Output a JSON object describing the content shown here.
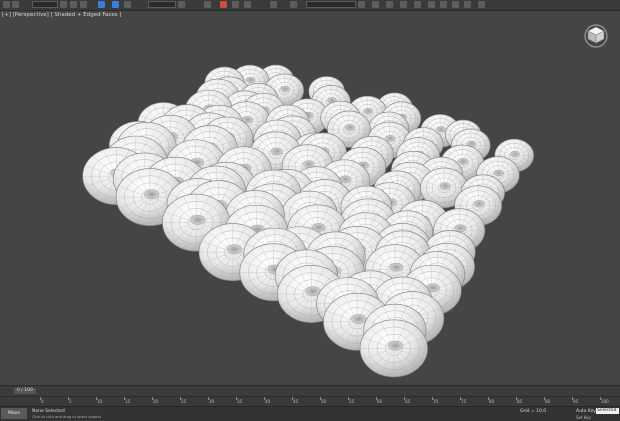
{
  "viewport": {
    "label": "[+] [Perspective] [ Shaded + Edged Faces ]"
  },
  "timeline": {
    "frame_counter": "0 / 100",
    "ticks": [
      "0",
      "5",
      "10",
      "15",
      "20",
      "25",
      "30",
      "35",
      "40",
      "45",
      "50",
      "55",
      "60",
      "65",
      "70",
      "75",
      "80",
      "85",
      "90",
      "95",
      "100"
    ]
  },
  "status": {
    "script_button": "Maxs",
    "selection": "None Selected",
    "prompt": "Click or click-and-drag to select objects",
    "grid": "Grid = 10,0",
    "autokey": "Auto Key",
    "selected_value": "Selected",
    "set_key": "Set Key"
  },
  "colors": {
    "background": "#454545",
    "mesh": "#e6e6e6",
    "wire": "#8f8f8f"
  }
}
